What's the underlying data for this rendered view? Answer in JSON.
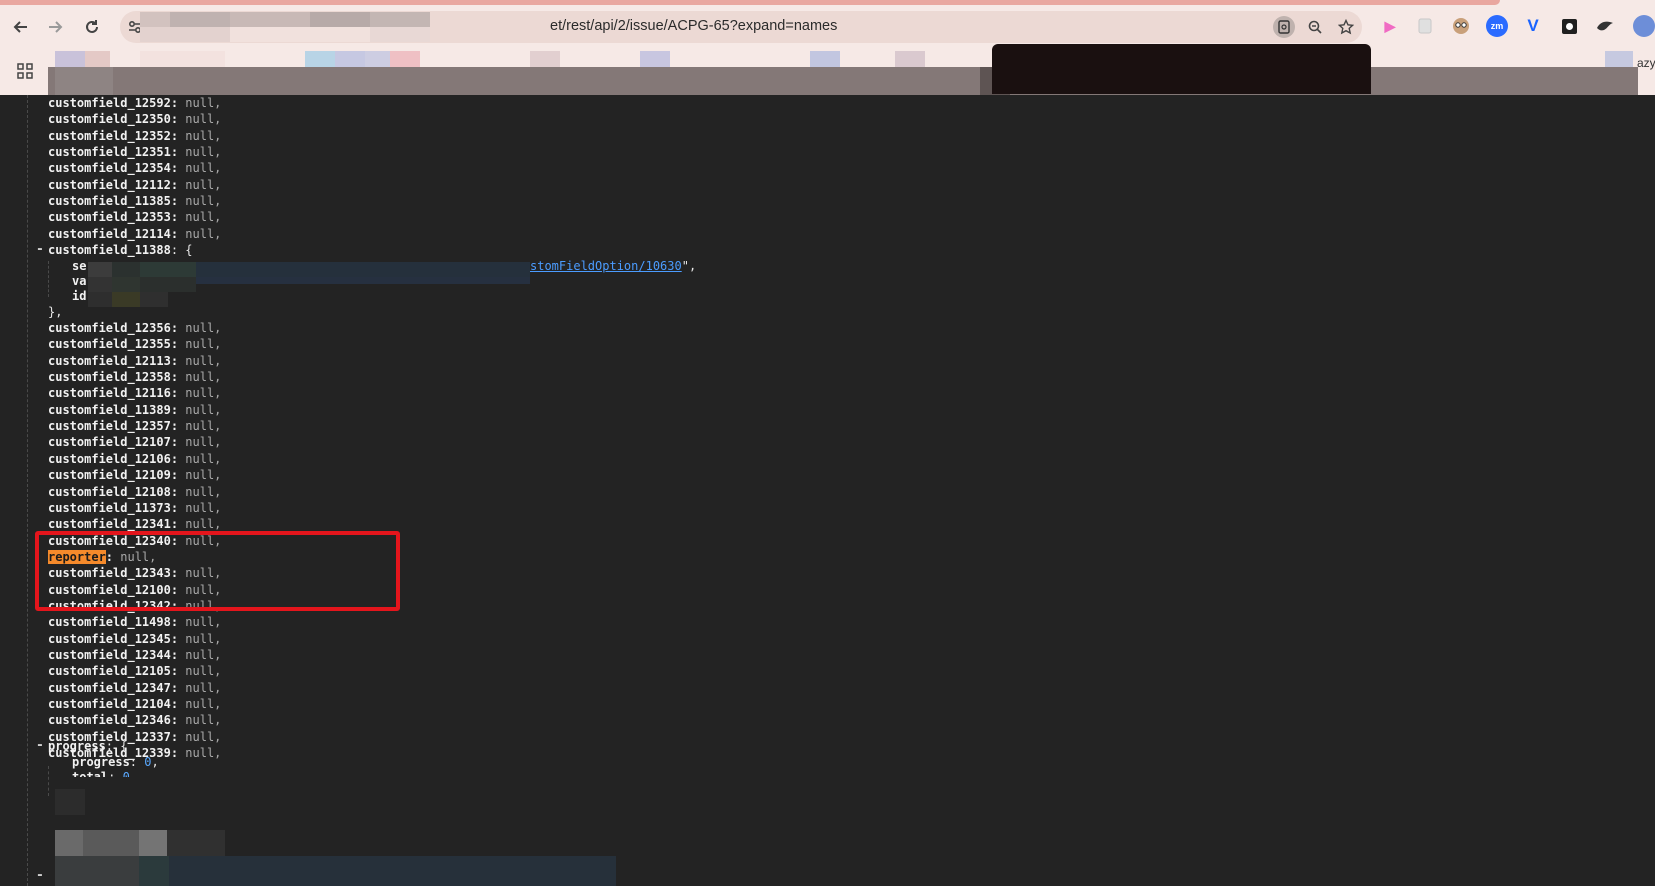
{
  "browser": {
    "url_text": "et/rest/api/2/issue/ACPG-65?expand=names",
    "extensions": [
      {
        "icon": "play-icon",
        "color": "#f06bc3"
      },
      {
        "icon": "doc-icon",
        "color": "#d8d8d8"
      },
      {
        "icon": "face-icon",
        "color": "#6b4f3a"
      },
      {
        "icon": "zm-icon",
        "color": "#2b6bff",
        "text": "zm"
      },
      {
        "icon": "v-icon",
        "color": "#1a63ff"
      },
      {
        "icon": "snap-icon",
        "color": "#202020"
      },
      {
        "icon": "bird-icon",
        "color": "#333333"
      },
      {
        "icon": "profile-icon",
        "color": "#6d8ed8"
      }
    ],
    "bookmark_tail_text": "azy"
  },
  "json_view": {
    "lines_top": [
      {
        "key": "customfield_12592",
        "value": "null,"
      },
      {
        "key": "customfield_12350",
        "value": "null,"
      },
      {
        "key": "customfield_12352",
        "value": "null,"
      },
      {
        "key": "customfield_12351",
        "value": "null,"
      },
      {
        "key": "customfield_12354",
        "value": "null,"
      },
      {
        "key": "customfield_12112",
        "value": "null,"
      },
      {
        "key": "customfield_11385",
        "value": "null,"
      },
      {
        "key": "customfield_12353",
        "value": "null,"
      },
      {
        "key": "customfield_12114",
        "value": "null,"
      }
    ],
    "object_11388": {
      "key": "customfield_11388",
      "open": "{",
      "self_key": "se",
      "self_link_tail": "stomFieldOption/10630",
      "self_after": "\",",
      "value_key": "va",
      "id_key": "id",
      "close": "},"
    },
    "lines_mid": [
      {
        "key": "customfield_12356",
        "value": "null,"
      },
      {
        "key": "customfield_12355",
        "value": "null,"
      },
      {
        "key": "customfield_12113",
        "value": "null,"
      },
      {
        "key": "customfield_12358",
        "value": "null,"
      },
      {
        "key": "customfield_12116",
        "value": "null,"
      },
      {
        "key": "customfield_11389",
        "value": "null,"
      },
      {
        "key": "customfield_12357",
        "value": "null,"
      },
      {
        "key": "customfield_12107",
        "value": "null,"
      },
      {
        "key": "customfield_12106",
        "value": "null,"
      },
      {
        "key": "customfield_12109",
        "value": "null,"
      },
      {
        "key": "customfield_12108",
        "value": "null,"
      },
      {
        "key": "customfield_11373",
        "value": "null,"
      },
      {
        "key": "customfield_12341",
        "value": "null,"
      },
      {
        "key": "customfield_12340",
        "value": "null,"
      },
      {
        "key": "reporter",
        "value": "null,",
        "highlight": true
      },
      {
        "key": "customfield_12343",
        "value": "null,"
      },
      {
        "key": "customfield_12100",
        "value": "null,"
      },
      {
        "key": "customfield_12342",
        "value": "null,"
      },
      {
        "key": "customfield_11498",
        "value": "null,"
      },
      {
        "key": "customfield_12345",
        "value": "null,"
      },
      {
        "key": "customfield_12344",
        "value": "null,"
      },
      {
        "key": "customfield_12105",
        "value": "null,"
      },
      {
        "key": "customfield_12347",
        "value": "null,"
      },
      {
        "key": "customfield_12104",
        "value": "null,"
      },
      {
        "key": "customfield_12346",
        "value": "null,"
      },
      {
        "key": "customfield_12337",
        "value": "null,"
      },
      {
        "key": "customfield_12339",
        "value": "null,"
      }
    ],
    "progress": {
      "key": "progress",
      "open": "{",
      "inner": [
        {
          "key": "progress",
          "value": "0",
          "suffix": ","
        },
        {
          "key": "total",
          "value": "0",
          "suffix": ""
        }
      ]
    },
    "toggle_symbol": "-"
  }
}
